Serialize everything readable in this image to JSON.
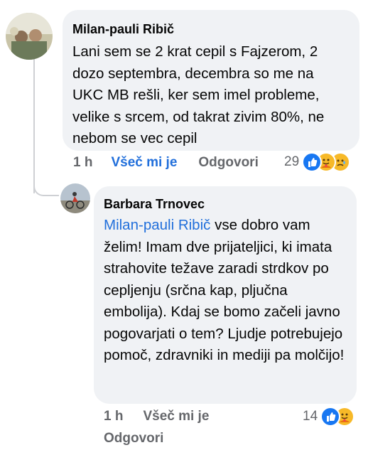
{
  "comments": [
    {
      "author": "Milan-pauli Ribič",
      "text": "Lani sem se 2 krat cepil s Fajzerom, 2 dozo septembra, decembra so me na UKC MB rešli, ker sem imel probleme, velike s srcem, od takrat zivim 80%, ne nebom se vec cepil",
      "time": "1 h",
      "like_label": "Všeč mi je",
      "reply_label": "Odgovori",
      "reaction_count": "29",
      "reaction_icons": [
        "like-icon",
        "care-icon",
        "sad-icon"
      ]
    },
    {
      "author": "Barbara Trnovec",
      "mention": "Milan-pauli Ribič",
      "text_line1_rest": " vse dobro",
      "text": "vam želim! Imam dve prijateljici, ki imata strahovite težave zaradi strdkov po cepljenju (srčna kap, pljučna embolija). Kdaj se bomo začeli javno pogovarjati o tem? Ljudje potrebujejo pomoč, zdravniki in mediji pa molčijo!",
      "time": "1 h",
      "like_label": "Všeč mi je",
      "reply_label": "Odgovori",
      "reaction_count": "14",
      "reaction_icons": [
        "like-icon",
        "care-icon"
      ]
    }
  ],
  "colors": {
    "bubble": "#f0f2f5",
    "link": "#216fdb",
    "meta": "#65676b",
    "like_blue": "#1877f2"
  }
}
